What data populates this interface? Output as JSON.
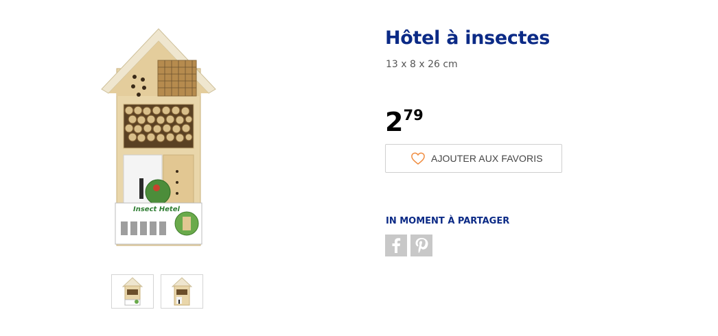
{
  "product": {
    "title": "Hôtel à insectes",
    "dimensions": "13 x 8 x 26 cm",
    "price_int": "2",
    "price_cents": "79",
    "package_label": "Insect Hetel"
  },
  "actions": {
    "favorite_label": "AJOUTER AUX FAVORIS",
    "favorite_icon": "heart-outline-icon"
  },
  "share": {
    "title": "IN MOMENT À PARTAGER",
    "networks": [
      "facebook-icon",
      "pinterest-icon"
    ]
  },
  "gallery": {
    "thumbnails": [
      "product-front-view",
      "product-without-packaging"
    ]
  },
  "colors": {
    "brand_blue": "#0b2a86",
    "heart": "#f08a3c",
    "social_bg": "#c8c8c8"
  }
}
